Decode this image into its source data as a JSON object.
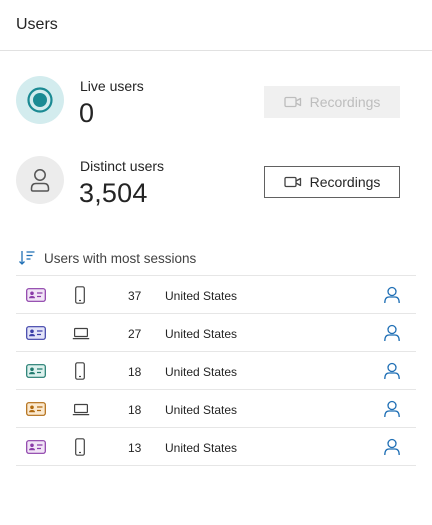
{
  "header": {
    "title": "Users"
  },
  "live": {
    "label": "Live users",
    "value": "0",
    "button_label": "Recordings",
    "button_enabled": false
  },
  "distinct": {
    "label": "Distinct users",
    "value": "3,504",
    "button_label": "Recordings",
    "button_enabled": true
  },
  "list": {
    "title": "Users with most sessions",
    "rows": [
      {
        "badge_color": "#8a3ba8",
        "badge_bg": "#f1e4f6",
        "device": "mobile",
        "sessions": "37",
        "country": "United States"
      },
      {
        "badge_color": "#3b3fa8",
        "badge_bg": "#e3e4f8",
        "device": "laptop",
        "sessions": "27",
        "country": "United States"
      },
      {
        "badge_color": "#1f7a6e",
        "badge_bg": "#dcf1ed",
        "device": "mobile",
        "sessions": "18",
        "country": "United States"
      },
      {
        "badge_color": "#b06a10",
        "badge_bg": "#fbe9cf",
        "device": "laptop",
        "sessions": "18",
        "country": "United States"
      },
      {
        "badge_color": "#8a3ba8",
        "badge_bg": "#f1e4f6",
        "device": "mobile",
        "sessions": "13",
        "country": "United States"
      }
    ]
  },
  "colors": {
    "accent_teal": "#1b8a93",
    "link_blue": "#1f6fb5",
    "border": "#e1e1e1"
  }
}
